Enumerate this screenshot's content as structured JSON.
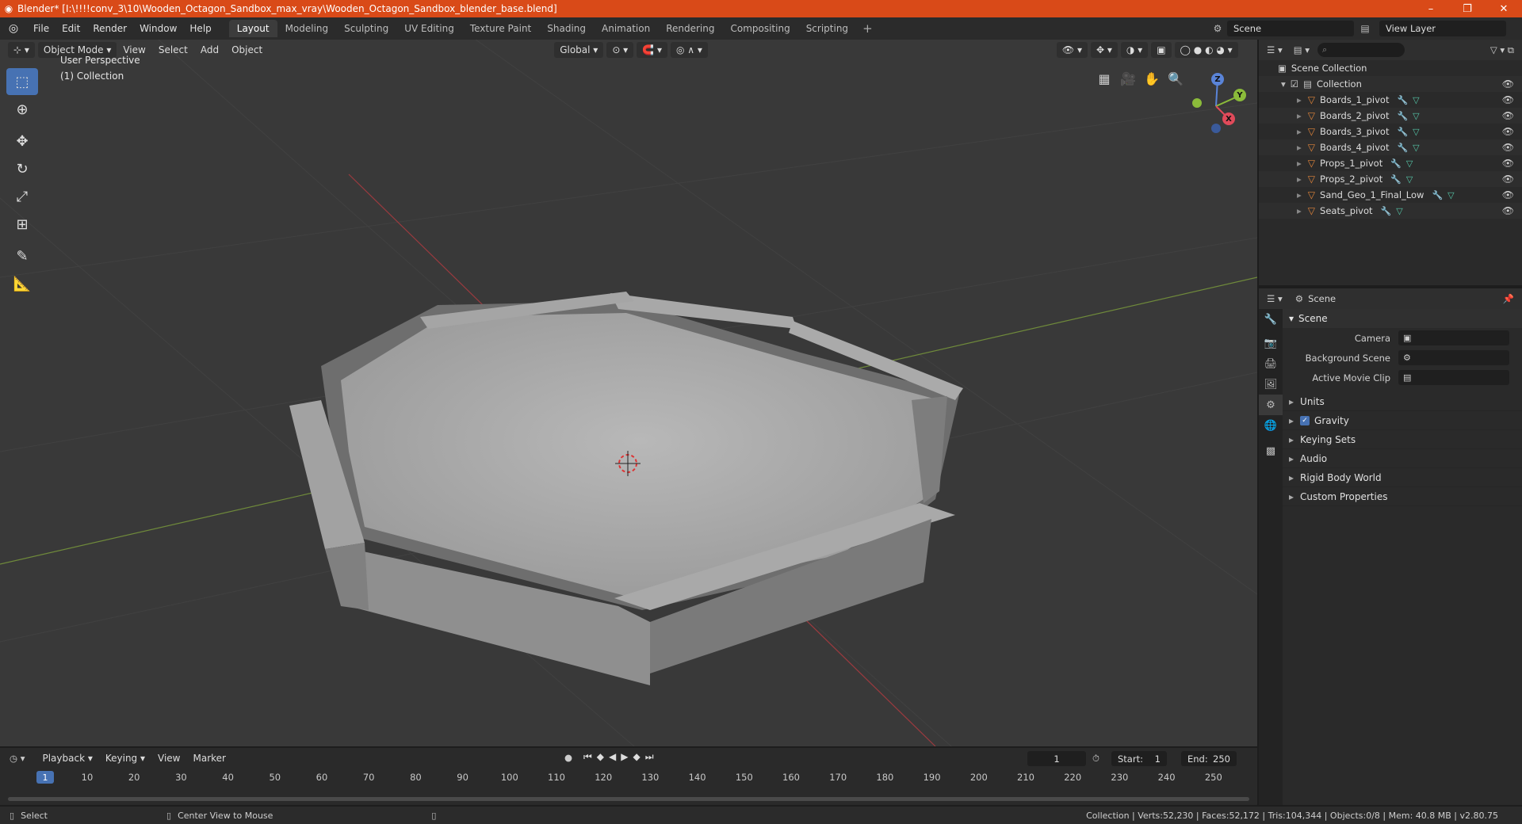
{
  "window": {
    "title": "Blender* [I:\\!!!!conv_3\\10\\Wooden_Octagon_Sandbox_max_vray\\Wooden_Octagon_Sandbox_blender_base.blend]",
    "minimize": "–",
    "restore": "❐",
    "close": "✕"
  },
  "menu": [
    "File",
    "Edit",
    "Render",
    "Window",
    "Help"
  ],
  "workspaces": [
    "Layout",
    "Modeling",
    "Sculpting",
    "UV Editing",
    "Texture Paint",
    "Shading",
    "Animation",
    "Rendering",
    "Compositing",
    "Scripting"
  ],
  "scene_name": "Scene",
  "view_layer": "View Layer",
  "viewport": {
    "mode": "Object Mode",
    "menus": [
      "View",
      "Select",
      "Add",
      "Object"
    ],
    "orientation": "Global",
    "perspective": "User Perspective",
    "collection": "(1) Collection",
    "gizmo": {
      "z": "Z",
      "y": "Y",
      "x": "X"
    }
  },
  "outliner": {
    "root": "Scene Collection",
    "collection": "Collection",
    "objects": [
      "Boards_1_pivot",
      "Boards_2_pivot",
      "Boards_3_pivot",
      "Boards_4_pivot",
      "Props_1_pivot",
      "Props_2_pivot",
      "Sand_Geo_1_Final_Low",
      "Seats_pivot"
    ]
  },
  "properties": {
    "header": "Scene",
    "panel": "Scene",
    "rows": [
      {
        "label": "Camera",
        "value": ""
      },
      {
        "label": "Background Scene",
        "value": ""
      },
      {
        "label": "Active Movie Clip",
        "value": ""
      }
    ],
    "subpanels": [
      "Units",
      "Gravity",
      "Keying Sets",
      "Audio",
      "Rigid Body World",
      "Custom Properties"
    ]
  },
  "timeline": {
    "menus": [
      "Playback",
      "Keying",
      "View",
      "Marker"
    ],
    "current_frame": "1",
    "start_label": "Start:",
    "start": "1",
    "end_label": "End:",
    "end": "250",
    "ticks": [
      "10",
      "20",
      "30",
      "40",
      "50",
      "60",
      "70",
      "80",
      "90",
      "100",
      "110",
      "120",
      "130",
      "140",
      "150",
      "160",
      "170",
      "180",
      "190",
      "200",
      "210",
      "220",
      "230",
      "240",
      "250"
    ],
    "playhead": "1"
  },
  "status": {
    "left_action": "Select",
    "mid_action": "Center View to Mouse",
    "right": "Collection | Verts:52,230 | Faces:52,172 | Tris:104,344 | Objects:0/8 | Mem: 40.8 MB | v2.80.75"
  }
}
